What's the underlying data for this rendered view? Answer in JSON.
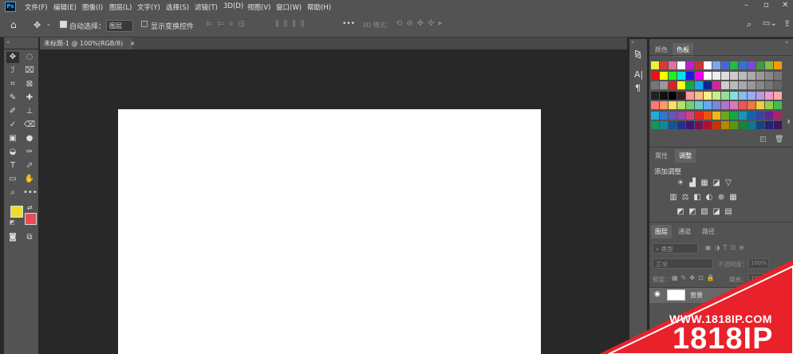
{
  "menu": [
    "文件(F)",
    "编辑(E)",
    "图像(I)",
    "图层(L)",
    "文字(Y)",
    "选择(S)",
    "滤镜(T)",
    "3D(D)",
    "视图(V)",
    "窗口(W)",
    "帮助(H)"
  ],
  "window_controls": [
    "–",
    "▫",
    "✕"
  ],
  "options": {
    "move_icon": "✥",
    "auto_select_label": "自动选择：",
    "auto_select_value": "图层",
    "transform_label": "显示变换控件",
    "mode_3d_label": "3D 模式：",
    "more": "•••"
  },
  "document_tab": {
    "title": "未标题-1 @ 100%(RGB/8)",
    "close": "×"
  },
  "tools": [
    "✥",
    "◌",
    "ℐ",
    "⌧",
    "⌗",
    "⊠",
    "✎",
    "✚",
    "✐",
    "⊥",
    "✓",
    "⌫",
    "▣",
    "●",
    "◒",
    "✑",
    "T",
    "⬀",
    "▭",
    "✋",
    "⌕",
    "•••"
  ],
  "colors": {
    "foreground": "#efdc2a",
    "background": "#e84b55"
  },
  "panels": {
    "top_tabs": [
      "颜色",
      "色板"
    ],
    "mid_tabs": [
      "属性",
      "调整"
    ],
    "adjust_title": "添加调整",
    "layer_tabs": [
      "图层",
      "通道",
      "路径"
    ],
    "layer_filter": "类型",
    "blend_mode": "正常",
    "opacity_label": "不透明度：",
    "opacity_value": "100%",
    "lock_label": "锁定：",
    "fill_label": "填充：",
    "fill_value": "100%",
    "layer_name": "背景"
  },
  "swatch_rows": [
    [
      "#efef3a",
      "#d93939",
      "#e070a0",
      "#ffffff",
      "#c01fd6",
      "#cc3333",
      "#ffffff",
      "#7ea6ee",
      "#4466dd",
      "#22bb44",
      "#2e74d6",
      "#7c4bd4",
      "#3f9a3f",
      "#88bb44",
      "#ff9900"
    ],
    [
      "#ee1111",
      "#ffff00",
      "#22ee22",
      "#00e5e5",
      "#1a1aee",
      "#ee00ee",
      "#ffffff",
      "#eeeeee",
      "#dddddd",
      "#cccccc",
      "#bbbbbb",
      "#aaaaaa",
      "#999999",
      "#888888",
      "#777777"
    ],
    [
      "#777777",
      "#999999",
      "#dd2222",
      "#ffff22",
      "#11aa44",
      "#11aaee",
      "#112299",
      "#dd2299",
      "#cccccc",
      "#bbbbbb",
      "#aaaaaa",
      "#999999",
      "#888888",
      "#777777",
      "#666666"
    ],
    [
      "#222222",
      "#111111",
      "#000000",
      "#332222",
      "#ff9999",
      "#ffbb88",
      "#ffee88",
      "#ccee88",
      "#99dd99",
      "#88dddd",
      "#88bbee",
      "#99aaee",
      "#bb99dd",
      "#ee99cc",
      "#ffaaaa"
    ],
    [
      "#ff7777",
      "#ff9966",
      "#ffdd66",
      "#bbdd66",
      "#77cc77",
      "#66cccc",
      "#66aaee",
      "#7788dd",
      "#aa77cc",
      "#dd77bb",
      "#ee5555",
      "#ee7744",
      "#eecc44",
      "#99cc44",
      "#44bb55"
    ],
    [
      "#22aadd",
      "#3377cc",
      "#6655bb",
      "#9944aa",
      "#cc4488",
      "#ee2222",
      "#ee5511",
      "#eebb11",
      "#66aa22",
      "#11aa44",
      "#1199bb",
      "#1166aa",
      "#3344aa",
      "#662299",
      "#aa2266"
    ],
    [
      "#119955",
      "#118899",
      "#115599",
      "#223388",
      "#441177",
      "#771155",
      "#aa1133",
      "#cc3300",
      "#bb8800",
      "#559911",
      "#118833",
      "#117788",
      "#114488",
      "#222277",
      "#441166"
    ]
  ],
  "adjust_icons": [
    [
      "☀",
      "▟",
      "▦",
      "◪",
      "▽"
    ],
    [
      "▥",
      "⚖",
      "◧",
      "◐",
      "⊕",
      "▦"
    ],
    [
      "◩",
      "◩",
      "▨",
      "◪",
      "▤"
    ]
  ],
  "watermark": {
    "url": "WWW.1818IP.COM",
    "brand": "1818IP"
  }
}
